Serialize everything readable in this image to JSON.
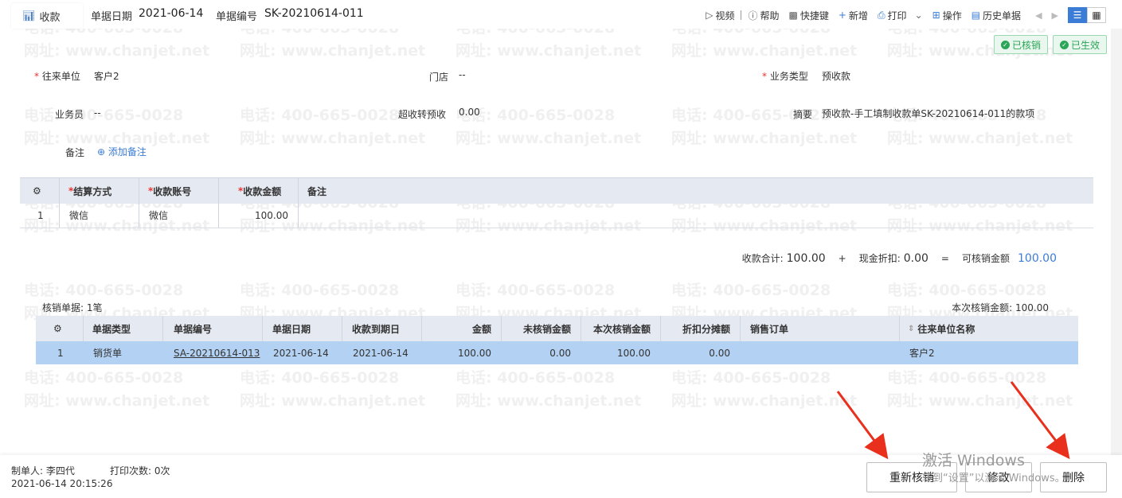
{
  "tab": {
    "title": "收款"
  },
  "header": {
    "date_label": "单据日期",
    "date_value": "2021-06-14",
    "code_label": "单据编号",
    "code_value": "SK-20210614-011"
  },
  "toolbar": {
    "video": "视频",
    "help": "帮助",
    "shortcut": "快捷键",
    "add": "新增",
    "print": "打印",
    "operate": "操作",
    "history": "历史单据"
  },
  "badges": {
    "verified": "已核销",
    "effective": "已生效"
  },
  "form": {
    "partner_label": "往来单位",
    "partner_value": "客户2",
    "store_label": "门店",
    "store_value": "--",
    "biztype_label": "业务类型",
    "biztype_value": "预收款",
    "salesman_label": "业务员",
    "salesman_value": "--",
    "overflow_label": "超收转预收",
    "overflow_value": "0.00",
    "summary_label": "摘要",
    "summary_value": "预收款-手工填制收款单SK-20210614-011的款项",
    "note_label": "备注",
    "note_add": "添加备注"
  },
  "settle_table": {
    "headers": [
      "结算方式",
      "收款账号",
      "收款金额",
      "备注"
    ],
    "rows": [
      {
        "no": "1",
        "method": "微信",
        "account": "微信",
        "amount": "100.00",
        "note": ""
      }
    ]
  },
  "totals": {
    "received_label": "收款合计:",
    "received_value": "100.00",
    "plus": "+",
    "discount_label": "现金折扣:",
    "discount_value": "0.00",
    "eq": "=",
    "available_label": "可核销金额",
    "available_value": "100.00"
  },
  "verify": {
    "count_text": "核销单据: 1笔",
    "amount_text": "本次核销金额: 100.00"
  },
  "verify_table": {
    "headers": [
      "单据类型",
      "单据编号",
      "单据日期",
      "收款到期日",
      "金额",
      "未核销金额",
      "本次核销金额",
      "折扣分摊额",
      "销售订单",
      "往来单位名称"
    ],
    "rows": [
      {
        "no": "1",
        "type": "销货单",
        "code": "SA-20210614-013",
        "date": "2021-06-14",
        "due": "2021-06-14",
        "amount": "100.00",
        "unverified": "0.00",
        "this_verify": "100.00",
        "discount": "0.00",
        "order": "",
        "partner": "客户2"
      }
    ]
  },
  "footer": {
    "creator": "制单人: 李四代",
    "print_count": "打印次数: 0次",
    "timestamp": "2021-06-14 20:15:26"
  },
  "buttons": {
    "reverify": "重新核销",
    "edit": "修改",
    "delete": "删除"
  },
  "windows_watermark": {
    "line1": "激活 Windows",
    "line2": "转到“设置”以激活 Windows。"
  },
  "watermark": {
    "phone": "电话: 400-665-0028",
    "site": "网址: www.chanjet.net"
  },
  "colors": {
    "accent": "#3b7cd6",
    "row_selected": "#b3d1f2",
    "header_bg": "#e5e9f1",
    "badge_green": "#2ba557",
    "arrow_red": "#e8301c"
  }
}
